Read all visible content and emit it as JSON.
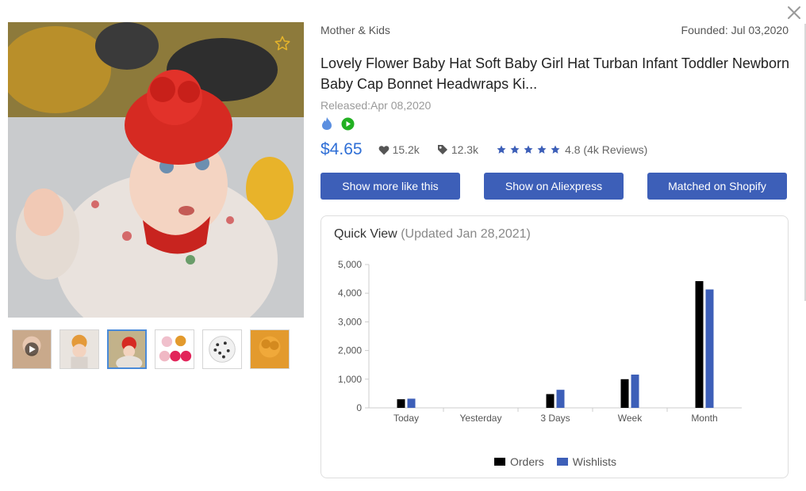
{
  "product": {
    "category": "Mother & Kids",
    "founded": "Founded: Jul 03,2020",
    "title": "Lovely Flower Baby Hat Soft Baby Girl Hat Turban Infant Toddler Newborn Baby Cap Bonnet Headwraps Ki...",
    "released": "Released:Apr 08,2020",
    "price": "$4.65",
    "wishlists": "15.2k",
    "orders": "12.3k",
    "rating_text": "4.8 (4k Reviews)",
    "rating": 4.8
  },
  "badges": [
    "hot-flame-icon",
    "video-play-icon"
  ],
  "buttons": {
    "more_like": "Show more like this",
    "aliexpress": "Show on Aliexpress",
    "shopify": "Matched on Shopify"
  },
  "quick_view": {
    "title": "Quick View",
    "updated": "(Updated Jan 28,2021)"
  },
  "thumbnails": [
    {
      "name": "thumb-video",
      "active": false
    },
    {
      "name": "thumb-2",
      "active": false
    },
    {
      "name": "thumb-3",
      "active": true
    },
    {
      "name": "thumb-4",
      "active": false
    },
    {
      "name": "thumb-5",
      "active": false
    },
    {
      "name": "thumb-6",
      "active": false
    }
  ],
  "colors": {
    "accent": "#3d5fb8",
    "price": "#2f6fd6",
    "orders": "#000000",
    "wishlists": "#3d5fb8",
    "star": "#3d5fb8"
  },
  "chart_data": {
    "type": "bar",
    "categories": [
      "Today",
      "Yesterday",
      "3 Days",
      "Week",
      "Month"
    ],
    "series": [
      {
        "name": "Orders",
        "color": "#000000",
        "values": [
          300,
          0,
          480,
          1000,
          4420
        ]
      },
      {
        "name": "Wishlists",
        "color": "#3d5fb8",
        "values": [
          320,
          0,
          630,
          1160,
          4130
        ]
      }
    ],
    "ylim": [
      0,
      5000
    ],
    "yticks": [
      0,
      1000,
      2000,
      3000,
      4000,
      5000
    ],
    "ytick_labels": [
      "0",
      "1,000",
      "2,000",
      "3,000",
      "4,000",
      "5,000"
    ],
    "legend": "bottom",
    "grid": false
  }
}
